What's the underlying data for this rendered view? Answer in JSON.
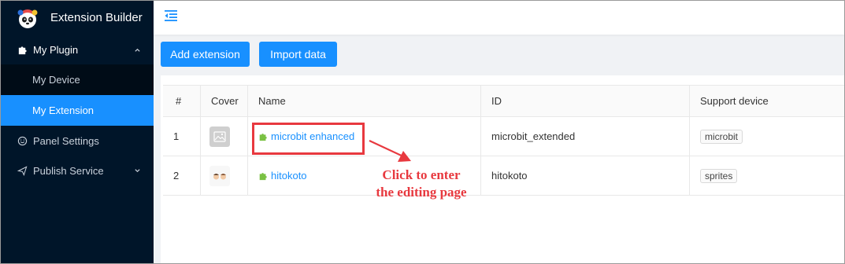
{
  "app": {
    "title": "Extension Builder"
  },
  "sidebar": {
    "menu": [
      {
        "label": "My Plugin",
        "icon": "puzzle-icon",
        "expanded": true,
        "children": [
          {
            "label": "My Device"
          },
          {
            "label": "My Extension",
            "active": true
          }
        ]
      },
      {
        "label": "Panel Settings",
        "icon": "smile-icon"
      },
      {
        "label": "Publish Service",
        "icon": "send-icon",
        "expanded": false
      }
    ]
  },
  "toolbar": {
    "add_label": "Add extension",
    "import_label": "Import data"
  },
  "table": {
    "headers": [
      "#",
      "Cover",
      "Name",
      "ID",
      "Support device"
    ],
    "rows": [
      {
        "index": "1",
        "cover": "image-placeholder-icon",
        "name": "microbit enhanced",
        "id": "microbit_extended",
        "device": "microbit"
      },
      {
        "index": "2",
        "cover": "faces-icon",
        "name": "hitokoto",
        "id": "hitokoto",
        "device": "sprites"
      }
    ]
  },
  "annotation": {
    "line1": "Click to enter",
    "line2": "the editing page"
  },
  "colors": {
    "sidebar": "#001529",
    "submenu": "#000c17",
    "accent": "#1890ff",
    "annotation": "#e8393f",
    "puzzle": "#7ac143"
  }
}
